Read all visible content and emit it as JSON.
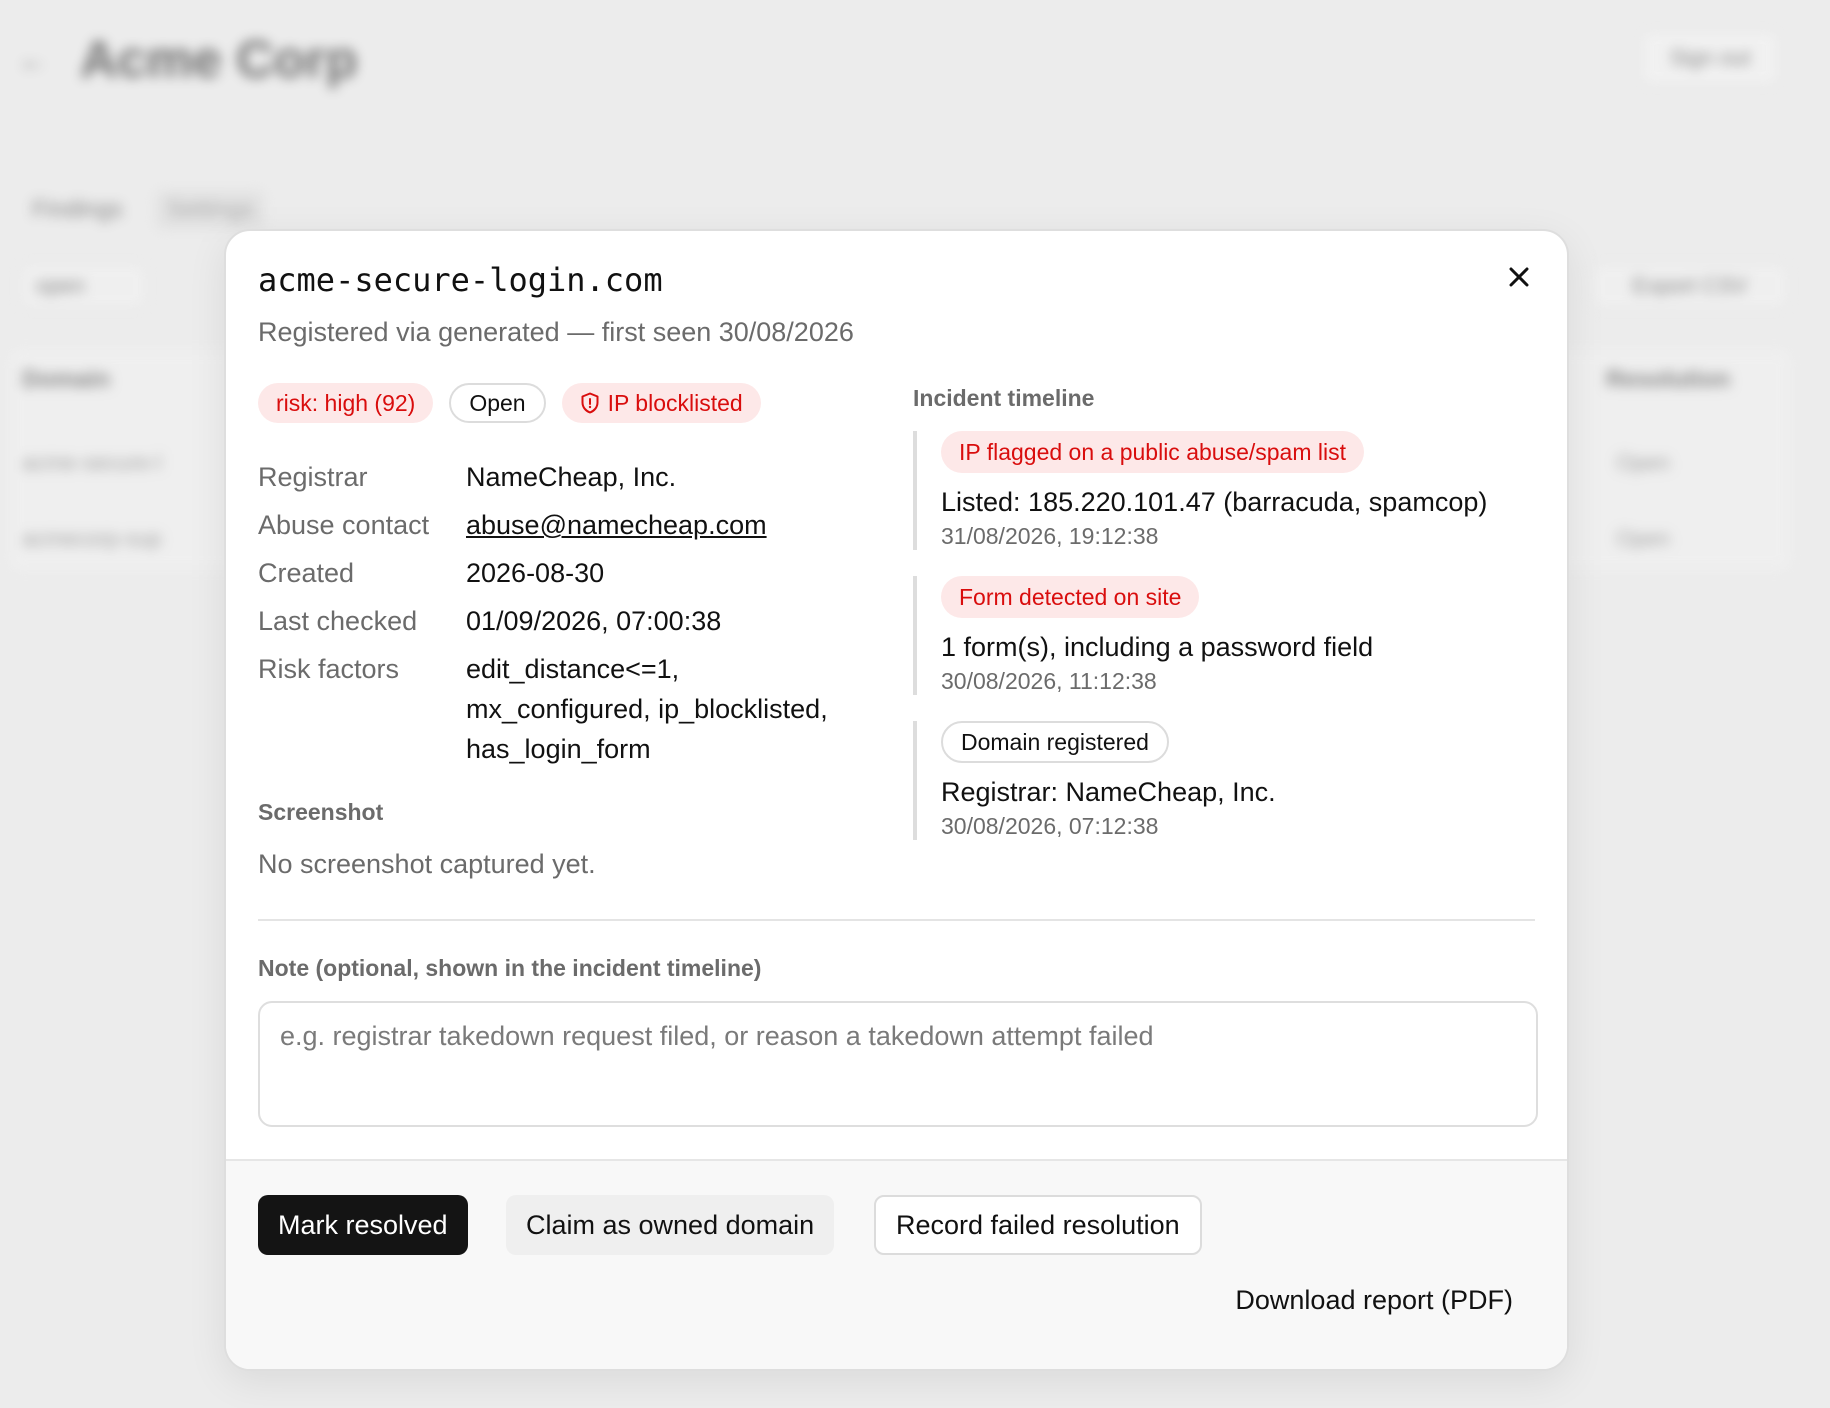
{
  "background": {
    "back_icon": "arrow-left-icon",
    "app_title": "Acme Corp",
    "signout_label": "Sign out",
    "tabs": [
      "Findings",
      "Settings"
    ],
    "filter_value": "open",
    "export_label": "Export CSV",
    "table_headers": [
      "Domain",
      "Resolution"
    ],
    "rows": [
      {
        "domain": "acme-secure-l",
        "resolution": "Open"
      },
      {
        "domain": "acmecorp-sup",
        "resolution": "Open"
      }
    ]
  },
  "modal": {
    "domain": "acme-secure-login.com",
    "subtitle": "Registered via generated — first seen 30/08/2026",
    "close_icon": "close-icon",
    "badges": {
      "risk": "risk: high (92)",
      "status": "Open",
      "ip": "IP blocklisted",
      "ip_icon": "shield-alert-icon"
    },
    "details": [
      {
        "key": "Registrar",
        "value": "NameCheap, Inc."
      },
      {
        "key": "Abuse contact",
        "value": "abuse@namecheap.com"
      },
      {
        "key": "Created",
        "value": "2026-08-30"
      },
      {
        "key": "Last checked",
        "value": "01/09/2026, 07:00:38"
      },
      {
        "key": "Risk factors",
        "value_lines": [
          "edit_distance<=1,",
          "mx_configured, ip_blocklisted,",
          "has_login_form"
        ]
      }
    ],
    "screenshot": {
      "label": "Screenshot",
      "empty_text": "No screenshot captured yet."
    },
    "timeline": {
      "label": "Incident timeline",
      "events": [
        {
          "badge": "IP flagged on a public abuse/spam list",
          "text": "Listed: 185.220.101.47 (barracuda, spamcop)",
          "time": "31/08/2026, 19:12:38"
        },
        {
          "badge": "Form detected on site",
          "text": "1 form(s), including a password field",
          "time": "30/08/2026, 11:12:38"
        },
        {
          "badge": "Domain registered",
          "text": "Registrar: NameCheap, Inc.",
          "time": "30/08/2026, 07:12:38"
        }
      ]
    },
    "note": {
      "label": "Note (optional, shown in the incident timeline)",
      "placeholder": "e.g. registrar takedown request filed, or reason a takedown attempt failed",
      "value": ""
    },
    "actions": {
      "mark_resolved": "Mark resolved",
      "claim_owned": "Claim as owned domain",
      "record_failed": "Record failed resolution",
      "download_report": "Download report (PDF)"
    }
  },
  "colors": {
    "danger": "#d90d0d",
    "danger_bg": "#fde8e8",
    "primary_button": "#141414",
    "muted_text": "#6b6b6b"
  }
}
